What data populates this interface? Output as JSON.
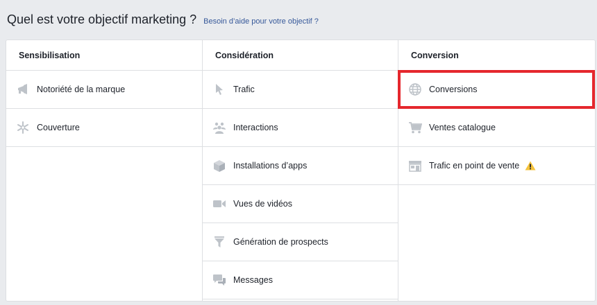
{
  "header": {
    "title": "Quel est votre objectif marketing ?",
    "help_link": "Besoin d’aide pour votre objectif ?"
  },
  "columns": [
    {
      "title": "Sensibilisation",
      "items": [
        {
          "label": "Notoriété de la marque",
          "icon": "megaphone-icon"
        },
        {
          "label": "Couverture",
          "icon": "snowflake-icon"
        }
      ]
    },
    {
      "title": "Considération",
      "items": [
        {
          "label": "Trafic",
          "icon": "cursor-icon"
        },
        {
          "label": "Interactions",
          "icon": "people-icon"
        },
        {
          "label": "Installations d’apps",
          "icon": "cube-icon"
        },
        {
          "label": "Vues de vidéos",
          "icon": "video-camera-icon"
        },
        {
          "label": "Génération de prospects",
          "icon": "funnel-icon"
        },
        {
          "label": "Messages",
          "icon": "chat-bubbles-icon"
        }
      ]
    },
    {
      "title": "Conversion",
      "items": [
        {
          "label": "Conversions",
          "icon": "globe-icon"
        },
        {
          "label": "Ventes catalogue",
          "icon": "shopping-cart-icon"
        },
        {
          "label": "Trafic en point de vente",
          "icon": "storefront-icon",
          "warning": "warning-icon"
        }
      ]
    }
  ],
  "colors": {
    "icon": "#bec3c9",
    "highlight": "#e5272d",
    "warning": "#f5c33b",
    "link": "#365899"
  }
}
